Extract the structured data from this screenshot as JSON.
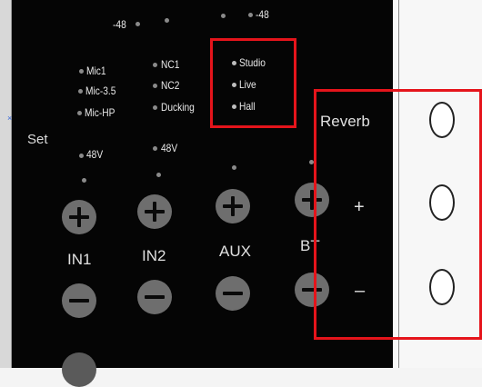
{
  "panel": {
    "set_label": "Set",
    "top_left_level": "-48",
    "top_right_level": "-48",
    "mic_options": [
      "Mic1",
      "Mic-3.5",
      "Mic-HP"
    ],
    "nc_options": [
      "NC1",
      "NC2",
      "Ducking"
    ],
    "effect_options": [
      "Studio",
      "Live",
      "Hall"
    ],
    "phantom_in1": "48V",
    "phantom_in2": "48V",
    "channels": [
      "IN1",
      "IN2",
      "AUX",
      "BT"
    ]
  },
  "reverb": {
    "title": "Reverb",
    "plus_label": "+",
    "minus_label": "–"
  },
  "colors": {
    "panel_bg": "#050505",
    "text": "#e9e9e9",
    "button": "#6e6e6e",
    "highlight": "#e5141b"
  },
  "icons": [
    "plus-icon",
    "minus-icon",
    "led-indicator",
    "oval-button-outline"
  ]
}
